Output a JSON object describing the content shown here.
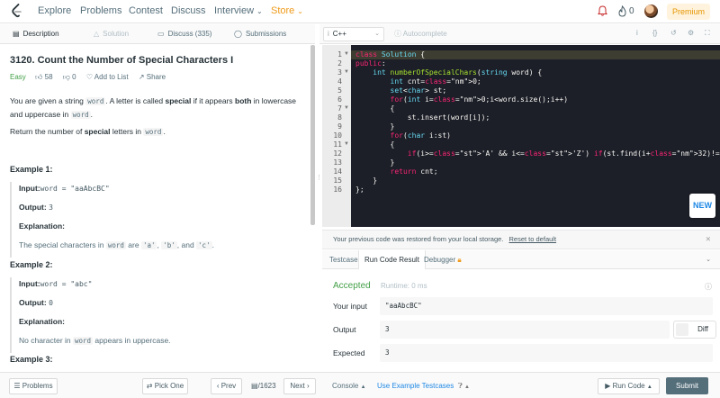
{
  "nav": {
    "items": [
      "Explore",
      "Problems",
      "Contest",
      "Discuss",
      "Interview",
      "Store"
    ],
    "fire_count": "0",
    "premium_label": "Premium"
  },
  "left_tabs": [
    "Description",
    "Solution",
    "Discuss (335)",
    "Submissions"
  ],
  "problem": {
    "title": "3120. Count the Number of Special Characters I",
    "difficulty": "Easy",
    "likes": "58",
    "dislikes": "0",
    "add_to_list": "Add to List",
    "share": "Share",
    "desc_1": [
      "You are given a string ",
      "word",
      ". A letter is called ",
      "special",
      " if it appears ",
      "both",
      " in lowercase and uppercase in ",
      "word",
      "."
    ],
    "desc_2": [
      "Return the number of ",
      "special",
      " letters in ",
      "word",
      "."
    ]
  },
  "examples": [
    {
      "title": "Example 1:",
      "input_label": "Input:",
      "input_value": "word = \"aaAbcBC\"",
      "output_label": "Output:",
      "output_value": "3",
      "explanation_label": "Explanation:",
      "explanation": [
        "The special characters in ",
        "word",
        " are ",
        "'a'",
        ", ",
        "'b'",
        ", and ",
        "'c'",
        "."
      ]
    },
    {
      "title": "Example 2:",
      "input_label": "Input:",
      "input_value": "word = \"abc\"",
      "output_label": "Output:",
      "output_value": "0",
      "explanation_label": "Explanation:",
      "explanation": [
        "No character in ",
        "word",
        " appears in uppercase."
      ]
    },
    {
      "title": "Example 3:"
    }
  ],
  "editor": {
    "language": "C++",
    "autocomplete": "Autocomplete",
    "code_lines": [
      "class Solution {",
      "public:",
      "    int numberOfSpecialChars(string word) {",
      "        int cnt=0;",
      "        set<char> st;",
      "        for(int i=0;i<word.size();i++)",
      "        {",
      "            st.insert(word[i]);",
      "        }",
      "        for(char i:st)",
      "        {",
      "            if(i>='A' && i<='Z') if(st.find(i+32)!=st.end()) cnt++;",
      "        }",
      "        return cnt;",
      "    }",
      "};"
    ],
    "line_numbers": [
      "1",
      "2",
      "3",
      "4",
      "5",
      "6",
      "7",
      "8",
      "9",
      "10",
      "11",
      "12",
      "13",
      "14",
      "15",
      "16"
    ],
    "new_badge": "NEW"
  },
  "restore": {
    "message": "Your previous code was restored from your local storage.",
    "link": "Reset to default"
  },
  "console_tabs": [
    "Testcase",
    "Run Code Result",
    "Debugger"
  ],
  "result": {
    "status": "Accepted",
    "runtime": "Runtime: 0 ms",
    "input_label": "Your input",
    "input_value": "\"aaAbcBC\"",
    "output_label": "Output",
    "output_value": "3",
    "expected_label": "Expected",
    "expected_value": "3",
    "diff_label": "Diff"
  },
  "bottom": {
    "problems": "Problems",
    "pick_one": "Pick One",
    "prev": "Prev",
    "counter": "/1623",
    "next": "Next",
    "console": "Console",
    "use_example": "Use Example Testcases",
    "run_code": "Run Code",
    "submit": "Submit"
  },
  "colors": {
    "accent_green": "#43a047",
    "store_orange": "#ef9a1a",
    "link_blue": "#1e88e5",
    "editor_bg": "#1c1e28",
    "submit_bg": "#546e7a"
  }
}
